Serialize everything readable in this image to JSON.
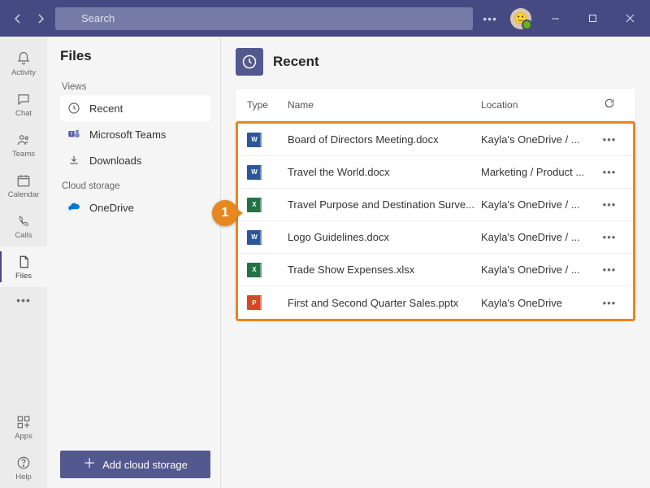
{
  "titlebar": {
    "search_placeholder": "Search",
    "colors": {
      "bg": "#454b82",
      "accent": "#53598f"
    }
  },
  "rail": {
    "items": [
      {
        "id": "activity",
        "label": "Activity"
      },
      {
        "id": "chat",
        "label": "Chat"
      },
      {
        "id": "teams",
        "label": "Teams"
      },
      {
        "id": "calendar",
        "label": "Calendar"
      },
      {
        "id": "calls",
        "label": "Calls"
      },
      {
        "id": "files",
        "label": "Files"
      }
    ],
    "active": "files",
    "footer": [
      {
        "id": "apps",
        "label": "Apps"
      },
      {
        "id": "help",
        "label": "Help"
      }
    ]
  },
  "sidebar": {
    "title": "Files",
    "sections": {
      "views_label": "Views",
      "views": [
        {
          "id": "recent",
          "label": "Recent",
          "active": true
        },
        {
          "id": "teams",
          "label": "Microsoft Teams"
        },
        {
          "id": "downloads",
          "label": "Downloads"
        }
      ],
      "cloud_label": "Cloud storage",
      "cloud": [
        {
          "id": "onedrive",
          "label": "OneDrive"
        }
      ]
    },
    "add_button": "Add cloud storage"
  },
  "main": {
    "header_title": "Recent",
    "columns": {
      "type": "Type",
      "name": "Name",
      "location": "Location"
    },
    "files": [
      {
        "icon": "w",
        "name": "Board of Directors Meeting.docx",
        "location": "Kayla's OneDrive / ..."
      },
      {
        "icon": "w",
        "name": "Travel the World.docx",
        "location": "Marketing / Product ..."
      },
      {
        "icon": "x",
        "name": "Travel Purpose and Destination Surve...",
        "location": "Kayla's OneDrive / ..."
      },
      {
        "icon": "w",
        "name": "Logo Guidelines.docx",
        "location": "Kayla's OneDrive / ..."
      },
      {
        "icon": "x",
        "name": "Trade Show Expenses.xlsx",
        "location": "Kayla's OneDrive / ..."
      },
      {
        "icon": "p",
        "name": "First and Second Quarter Sales.pptx",
        "location": "Kayla's OneDrive"
      }
    ],
    "callout_number": "1"
  }
}
